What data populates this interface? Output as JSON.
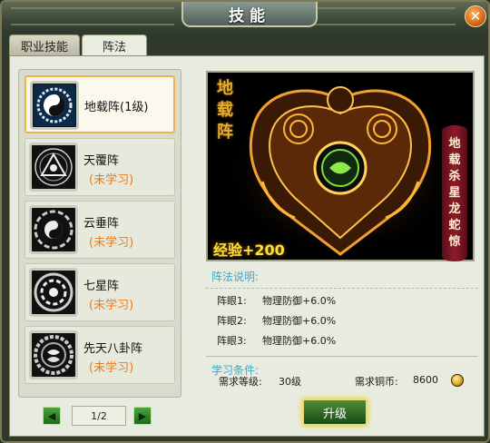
{
  "window": {
    "title": "技能"
  },
  "tabs": [
    {
      "label": "职业技能"
    },
    {
      "label": "阵法"
    }
  ],
  "formations": [
    {
      "name": "地载阵(1级)",
      "status": ""
    },
    {
      "name": "天覆阵",
      "status": "(未学习)"
    },
    {
      "name": "云垂阵",
      "status": "(未学习)"
    },
    {
      "name": "七星阵",
      "status": "(未学习)"
    },
    {
      "name": "先天八卦阵",
      "status": "(未学习)"
    }
  ],
  "pager": {
    "page": "1/2"
  },
  "preview": {
    "left_text": [
      "地",
      "载",
      "阵"
    ],
    "right_text": [
      "地",
      "载",
      "杀",
      "星",
      "龙",
      "蛇",
      "惊"
    ],
    "exp": "经验+200"
  },
  "description": {
    "title": "阵法说明:",
    "eyes": [
      {
        "label": "阵眼1:",
        "value": "物理防御+6.0%"
      },
      {
        "label": "阵眼2:",
        "value": "物理防御+6.0%"
      },
      {
        "label": "阵眼3:",
        "value": "物理防御+6.0%"
      }
    ]
  },
  "requirements": {
    "title": "学习条件:",
    "level_label": "需求等级:",
    "level_value": "30级",
    "copper_label": "需求铜币:",
    "copper_value": "8600"
  },
  "upgrade_button": "升级",
  "colors": {
    "accent": "#e87b1c",
    "title_blue": "#3ea8c6",
    "gold": "#f7e13a"
  }
}
